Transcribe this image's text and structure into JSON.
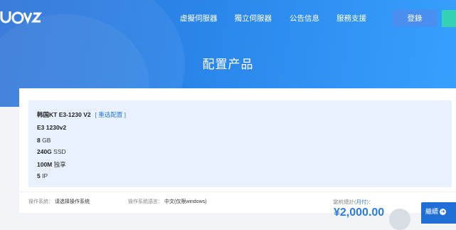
{
  "header": {
    "logo_text": "UOVZ",
    "nav": [
      {
        "label": "虚擬伺服器"
      },
      {
        "label": "獨立伺服器"
      },
      {
        "label": "公告信息"
      },
      {
        "label": "服務支援"
      }
    ],
    "login_label": "登錄"
  },
  "page_title": "配置产品",
  "config": {
    "product_name": "韩国KT E3-1230 V2",
    "reselect_label": "[ 重选配置 ]",
    "specs": [
      {
        "bold": "E3 1230v2",
        "rest": ""
      },
      {
        "bold": "8",
        "rest": " GB"
      },
      {
        "bold": "240G",
        "rest": " SSD"
      },
      {
        "bold": "100M",
        "rest": " 独享"
      },
      {
        "bold": "5",
        "rest": " IP"
      }
    ]
  },
  "bottom": {
    "os_label": "操作系統：",
    "os_value": "请选择操作系统",
    "lang_label": "操作系統語言：",
    "lang_value": "中文(仅限windows)",
    "price_label": "當前總計(",
    "price_cycle": "月付",
    "price_label_end": ")：",
    "price": "¥2,000.00",
    "checkout_label": "繼續"
  },
  "colors": {
    "primary": "#2b86ea",
    "accent": "#2a7ae4",
    "register": "#34d1b4"
  }
}
